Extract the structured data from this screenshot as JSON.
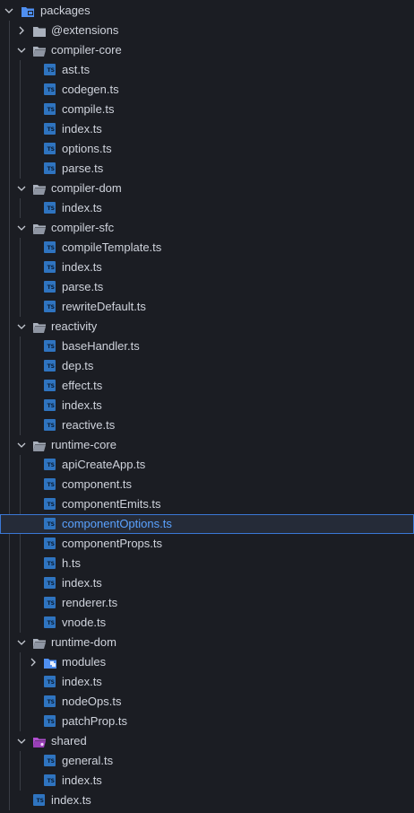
{
  "explorer": {
    "root": "packages",
    "extensions": "@extensions",
    "compiler_core": {
      "name": "compiler-core",
      "files": [
        "ast.ts",
        "codegen.ts",
        "compile.ts",
        "index.ts",
        "options.ts",
        "parse.ts"
      ]
    },
    "compiler_dom": {
      "name": "compiler-dom",
      "files": [
        "index.ts"
      ]
    },
    "compiler_sfc": {
      "name": "compiler-sfc",
      "files": [
        "compileTemplate.ts",
        "index.ts",
        "parse.ts",
        "rewriteDefault.ts"
      ]
    },
    "reactivity": {
      "name": "reactivity",
      "files": [
        "baseHandler.ts",
        "dep.ts",
        "effect.ts",
        "index.ts",
        "reactive.ts"
      ]
    },
    "runtime_core": {
      "name": "runtime-core",
      "files": [
        "apiCreateApp.ts",
        "component.ts",
        "componentEmits.ts",
        "componentOptions.ts",
        "componentProps.ts",
        "h.ts",
        "index.ts",
        "renderer.ts",
        "vnode.ts"
      ]
    },
    "runtime_dom": {
      "name": "runtime-dom",
      "modules": "modules",
      "files": [
        "index.ts",
        "nodeOps.ts",
        "patchProp.ts"
      ]
    },
    "shared": {
      "name": "shared",
      "files": [
        "general.ts",
        "index.ts"
      ]
    },
    "root_file": "index.ts",
    "ts_badge": "TS",
    "selected_file": "componentOptions.ts",
    "colors": {
      "background": "#1b1d23",
      "text": "#cfd3dc",
      "folder": "#aab1bd",
      "packages_folder": "#4f8ff0",
      "shared_folder": "#b04fd0",
      "modules_folder": "#4f8ff0",
      "ts_icon": "#2f74c0",
      "selection_border": "#3a78d6",
      "selection_text": "#5aa2ff",
      "indent_guide": "#3a3d45"
    }
  }
}
